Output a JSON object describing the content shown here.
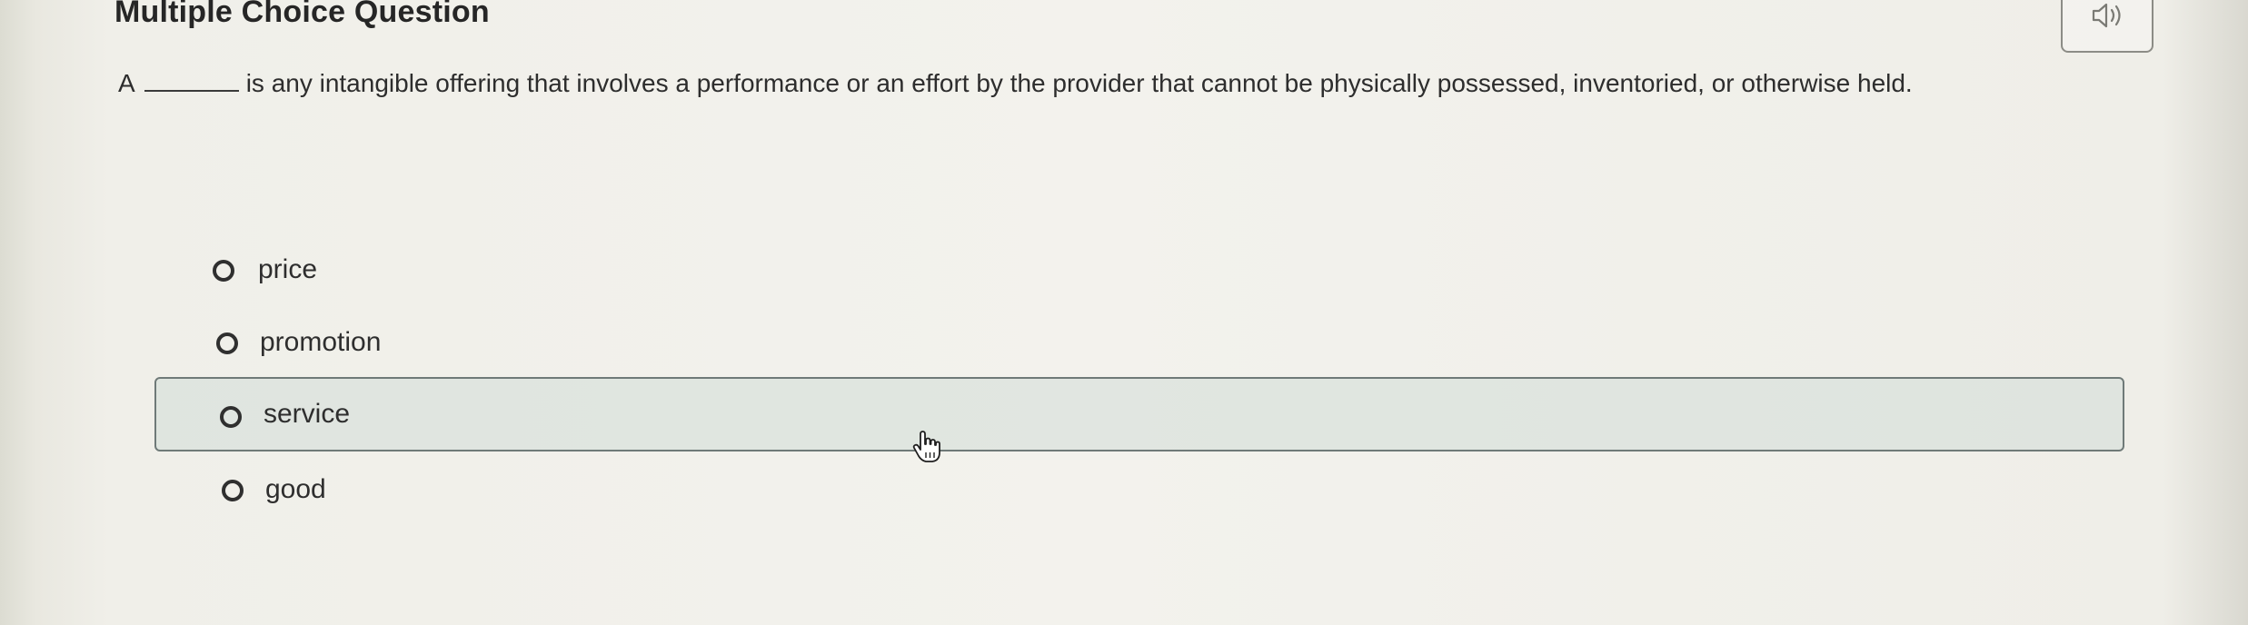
{
  "header": {
    "title": "Multiple Choice Question"
  },
  "audio": {
    "icon": "speaker-icon"
  },
  "question": {
    "prefix": "A",
    "suffix": "is any intangible offering that involves a performance or an effort by the provider that cannot be physically possessed, inventoried, or otherwise held."
  },
  "options": [
    {
      "label": "price",
      "selected": false
    },
    {
      "label": "promotion",
      "selected": false
    },
    {
      "label": "service",
      "selected": false,
      "hovered": true
    },
    {
      "label": "good",
      "selected": false
    }
  ],
  "colors": {
    "highlight_border": "#6f7a78",
    "highlight_fill": "#d2dcd7",
    "text": "#2e2e2e"
  }
}
